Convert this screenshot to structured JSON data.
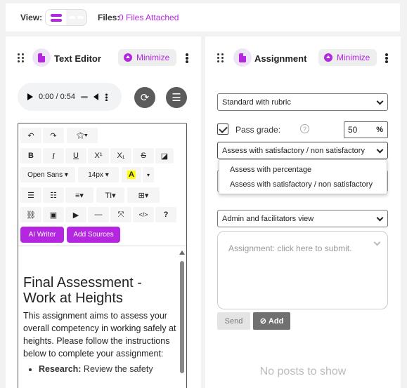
{
  "topbar": {
    "view_label": "View:",
    "files_label": "Files:",
    "files_link": "0 Files Attached"
  },
  "left_panel": {
    "title": "Text Editor",
    "minimize_label": "Minimize",
    "audio": {
      "time": "0:00 / 0:54"
    },
    "toolbar": {
      "undo": "↶",
      "redo": "↷",
      "magic": "⚝▾",
      "bold": "B",
      "italic": "I",
      "underline": "U",
      "superscript": "X¹",
      "subscript": "X₁",
      "strike": "S",
      "eraser": "◪",
      "font_family": "Open Sans ▾",
      "font_size": "14px ▾",
      "font_color": "A",
      "color_caret": "▾",
      "ul": "☰",
      "ol": "☷",
      "align": "≡▾",
      "text_height": "TI▾",
      "table": "⊞▾",
      "link": "⛓",
      "image": "▣",
      "video": "▶",
      "hr": "—",
      "fullscreen": "⤧",
      "code": "</>",
      "help": "?",
      "ai_writer": "AI Writer",
      "add_sources": "Add Sources"
    },
    "content": {
      "heading": "Final Assessment - Work at Heights",
      "paragraph": "This assignment aims to assess your overall competency in working safely at heights. Please follow the instructions below to complete your assignment:",
      "bullet_bold": "Research:",
      "bullet_text": " Review the safety"
    }
  },
  "right_panel": {
    "title": "Assignment",
    "minimize_label": "Minimize",
    "rubric_select": "Standard with rubric",
    "pass_grade_label": "Pass grade:",
    "help_icon": "?",
    "pass_grade_value": "50",
    "pass_grade_unit": "%",
    "assess_select": "Assess with satisfactory / non satisfactory",
    "dropdown_options": [
      "Assess with percentage",
      "Assess with satisfactory / non satisfactory"
    ],
    "view_select": "Admin and facilitators view",
    "textarea_placeholder": "Assignment: click here to submit.",
    "send_label": "Send",
    "add_label": "Add",
    "no_posts": "No posts to show"
  },
  "colors": {
    "accent": "#b526e0",
    "accent_soft": "#efe3f7",
    "dark_button": "#5b5b5b"
  }
}
